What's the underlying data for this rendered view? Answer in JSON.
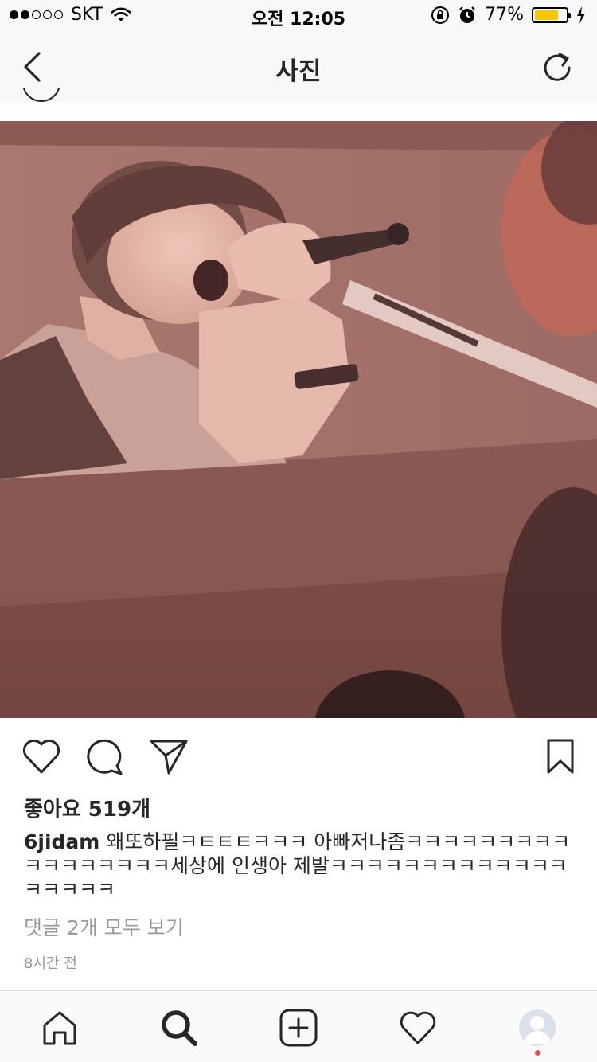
{
  "status_bar": {
    "carrier": "SKT",
    "time": "오전 12:05",
    "battery_percent": "77%",
    "battery_level": 0.77,
    "signal_bars_filled": 2,
    "signal_bars_total": 5,
    "icons": [
      "wifi-icon",
      "rotation-lock-icon",
      "alarm-icon",
      "battery-icon",
      "charging-bolt-icon"
    ]
  },
  "nav": {
    "title": "사진",
    "back_icon": "chevron-left-icon",
    "refresh_icon": "refresh-icon"
  },
  "post": {
    "likes": "좋아요 519개",
    "username": "6jidam",
    "caption_text": "왜또하필ㅋㅌㅌㅌㅋㅋㅋ 아빠저나좀ㅋㅋㅋㅋㅋㅋㅋㅋㅋㅋㅋㅋㅋㅋㅋㅋㅋ세상에 인생아 제발ㅋㅋㅋㅋㅋㅋㅋㅋㅋㅋㅋㅋㅋㅋㅋㅋㅋㅋ",
    "view_comments": "댓글 2개 모두 보기",
    "time_ago": "8시간 전",
    "action_icons": [
      "heart-icon",
      "comment-icon",
      "send-icon",
      "bookmark-icon"
    ]
  },
  "tab_bar": {
    "tabs": [
      "home-icon",
      "search-icon",
      "add-icon",
      "activity-icon",
      "profile-avatar"
    ],
    "active": "search-icon"
  },
  "colors": {
    "text": "#262626",
    "muted": "#999999",
    "battery": "#f8c700",
    "notification": "#ed4956",
    "bar_bg": "#f8f8f8"
  }
}
